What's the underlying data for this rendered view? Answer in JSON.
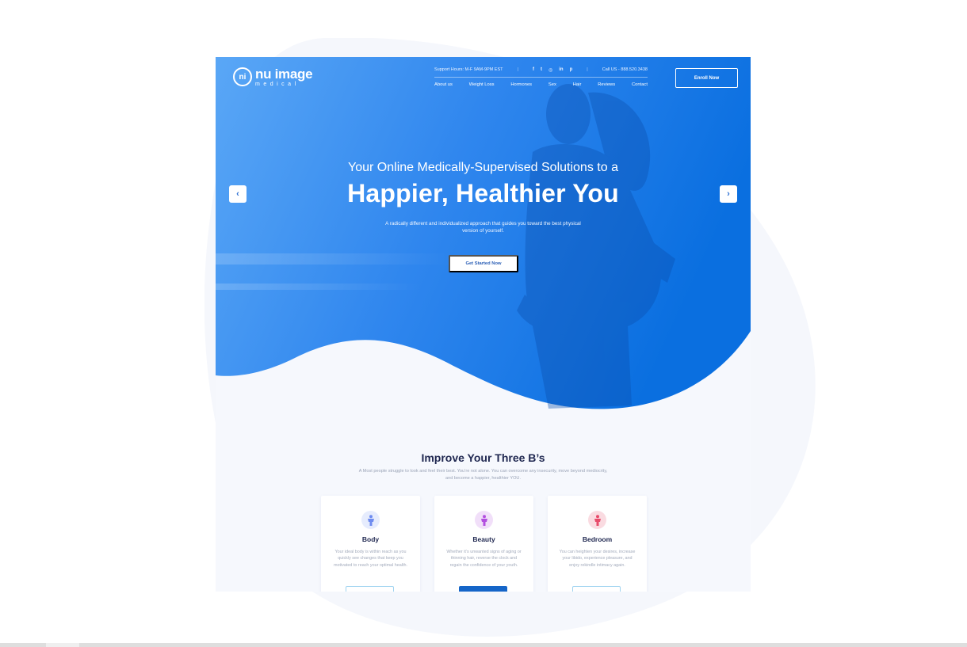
{
  "brand": {
    "logo_mark": "ni",
    "name": "nu image",
    "subtitle": "medical",
    "blue": "#1f7cea",
    "blue_dark": "#0f6ad8"
  },
  "topbar": {
    "support_hours": "Support Hours: M-F 9AM-9PM EST",
    "social_icons": [
      "facebook-icon",
      "twitter-icon",
      "instagram-icon",
      "linkedin-icon",
      "pinterest-icon"
    ],
    "social_glyphs": [
      "f",
      "t",
      "◎",
      "in",
      "p"
    ],
    "call": "Call US - 888.520.3438"
  },
  "nav": {
    "items": [
      "About us",
      "Weight Loss",
      "Hormones",
      "Sex",
      "Hair",
      "Reviews",
      "Contact"
    ]
  },
  "header": {
    "enroll_label": "Enroll Now"
  },
  "hero": {
    "subtitle": "Your Online Medically-Supervised Solutions to a",
    "title": "Happier, Healthier You",
    "description": "A radically different and individualized approach that guides you toward the best physical version of yourself.",
    "cta_label": "Get Started Now",
    "prev_arrow": "‹",
    "next_arrow": "›"
  },
  "section": {
    "title": "Improve Your Three B’s",
    "description": "A Most people struggle to look and feel their best. You’re not alone. You can overcome any insecurity, move beyond mediocrity, and become a happier, healthier YOU."
  },
  "cards": [
    {
      "title": "Body",
      "text": "Your ideal body is within reach as you quickly see changes that keep you motivated to reach your optimal health.",
      "icon": "person-icon",
      "icon_color": "#6f8cf0",
      "icon_bg": "#e6ecfd"
    },
    {
      "title": "Beauty",
      "text": "Whether it’s unwanted signs of aging or thinning hair, reverse the clock and regain the confidence of your youth.",
      "icon": "person-icon",
      "icon_color": "#b34fe0",
      "icon_bg": "#f1dff9"
    },
    {
      "title": "Bedroom",
      "text": "You can heighten your desires, increase your libido, experience pleasure, and enjoy rekindle intimacy again.",
      "icon": "person-icon",
      "icon_color": "#e84b6a",
      "icon_bg": "#fadbe1"
    }
  ]
}
